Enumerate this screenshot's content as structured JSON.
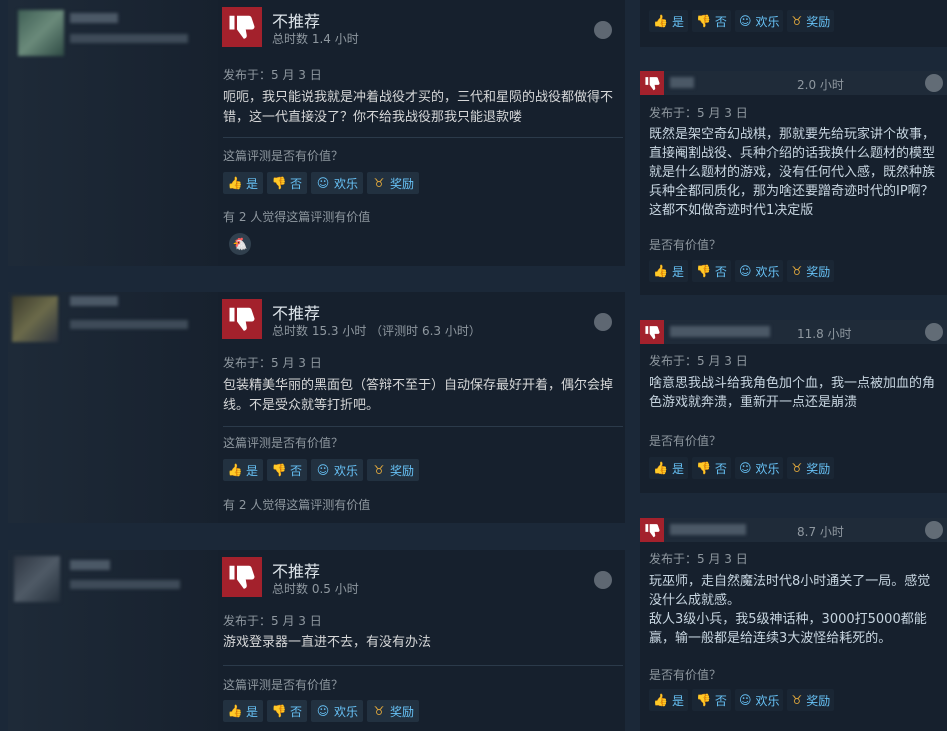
{
  "left_reviews": [
    {
      "title": "不推荐",
      "hours": "总时数 1.4 小时",
      "posted": "发布于：5 月 3 日",
      "text": "呃呃，我只能说我就是冲着战役才买的，三代和星陨的战役都做得不错，这一代直接没了？你不给我战役那我只能退款喽",
      "helpful_q": "这篇评测是否有价值？",
      "buttons": {
        "yes": "是",
        "no": "否",
        "funny": "欢乐",
        "award": "奖励"
      },
      "count": "有 2 人觉得这篇评测有价值",
      "emoji": "🐔"
    },
    {
      "title": "不推荐",
      "hours": "总时数 15.3 小时 （评测时 6.3 小时）",
      "posted": "发布于：5 月 3 日",
      "text": "包装精美华丽的黑面包（答辩不至于）自动保存最好开着，偶尔会掉线。不是受众就等打折吧。",
      "helpful_q": "这篇评测是否有价值？",
      "buttons": {
        "yes": "是",
        "no": "否",
        "funny": "欢乐",
        "award": "奖励"
      },
      "count": "有 2 人觉得这篇评测有价值"
    },
    {
      "title": "不推荐",
      "hours": "总时数 0.5 小时",
      "posted": "发布于：5 月 3 日",
      "text": "游戏登录器一直进不去，有没有办法",
      "helpful_q": "这篇评测是否有价值？",
      "buttons": {
        "yes": "是",
        "no": "否",
        "funny": "欢乐",
        "award": "奖励"
      }
    }
  ],
  "right_top_buttons": {
    "yes": "是",
    "no": "否",
    "funny": "欢乐",
    "award": "奖励"
  },
  "right_reviews": [
    {
      "hours": "2.0 小时",
      "posted": "发布于：5 月 3 日",
      "text": "既然是架空奇幻战棋，那就要先给玩家讲个故事，直接阉割战役、兵种介绍的话我换什么题材的模型就是什么题材的游戏，没有任何代入感，既然种族兵种全都同质化，那为啥还要蹭奇迹时代的IP啊？这都不如做奇迹时代1决定版",
      "helpful_q": "是否有价值？",
      "buttons": {
        "yes": "是",
        "no": "否",
        "funny": "欢乐",
        "award": "奖励"
      }
    },
    {
      "hours": "11.8 小时",
      "posted": "发布于：5 月 3 日",
      "text": "啥意思我战斗给我角色加个血，我一点被加血的角色游戏就奔溃，重新开一点还是崩溃",
      "helpful_q": "是否有价值？",
      "buttons": {
        "yes": "是",
        "no": "否",
        "funny": "欢乐",
        "award": "奖励"
      }
    },
    {
      "hours": "8.7 小时",
      "posted": "发布于：5 月 3 日",
      "text": "玩巫师，走自然魔法时代8小时通关了一局。感觉没什么成就感。\n敌人3级小兵，我5级神话种，3000打5000都能赢，输一般都是给连续3大波怪给耗死的。",
      "helpful_q": "是否有价值？",
      "buttons": {
        "yes": "是",
        "no": "否",
        "funny": "欢乐",
        "award": "奖励"
      }
    }
  ],
  "colors": {
    "background": "#1b2838",
    "card": "#16202d",
    "not_recommended": "#a3212c",
    "link": "#67c1f5",
    "award": "#d9a33c"
  }
}
